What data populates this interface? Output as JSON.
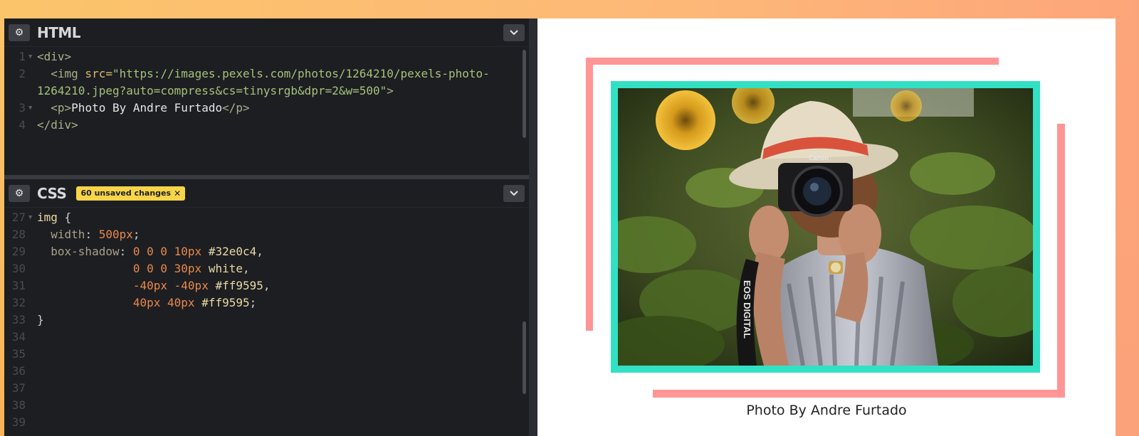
{
  "html_pane": {
    "title": "HTML",
    "lines": [
      {
        "n": "1",
        "fold": true
      },
      {
        "n": "2",
        "fold": false
      },
      {
        "n": "",
        "fold": false
      },
      {
        "n": "3",
        "fold": true
      },
      {
        "n": "4",
        "fold": false
      }
    ],
    "code": {
      "l1_open": "<div>",
      "l2_tag": "<img",
      "l2_attr": " src=",
      "l2_str_a": "\"https://images.pexels.com/photos/1264210/pexels-photo-",
      "l2_str_b": "1264210.jpeg?auto=compress&cs=tinysrgb&dpr=2&w=500\"",
      "l2_close": ">",
      "l3_open": "<p>",
      "l3_text": "Photo By Andre Furtado",
      "l3_close": "</p>",
      "l4_close": "</div>"
    }
  },
  "css_pane": {
    "title": "CSS",
    "badge": "60 unsaved changes",
    "badge_close": "✕",
    "line_numbers": [
      "27",
      "28",
      "29",
      "30",
      "31",
      "32",
      "33",
      "34",
      "35",
      "36",
      "37",
      "38",
      "39"
    ],
    "code": {
      "sel": "img",
      "brace_open": " {",
      "width_prop": "width",
      "width_val": "500px",
      "shadow_prop": "box-shadow",
      "s1_nums": "0 0 0 10px",
      "s1_color": "#32e0c4",
      "s2_nums": "0 0 0 30px",
      "s2_color": "white",
      "s3_nums": "-40px -40px",
      "s3_color": "#ff9595",
      "s4_nums": "40px 40px",
      "s4_color": "#ff9595",
      "brace_close": "}"
    }
  },
  "preview": {
    "caption": "Photo By Andre Furtado",
    "photo_alt": "woman photographing with a camera in a sunflower field",
    "camera_brand": "Canon",
    "strap_text": "EOS DIGITAL"
  },
  "icons": {
    "gear": "gear-icon",
    "chevron": "chevron-down-icon",
    "close": "close-icon"
  },
  "colors": {
    "teal": "#32e0c4",
    "pink": "#ff9595",
    "badge": "#f8d548",
    "editor_bg": "#1d1e22"
  }
}
